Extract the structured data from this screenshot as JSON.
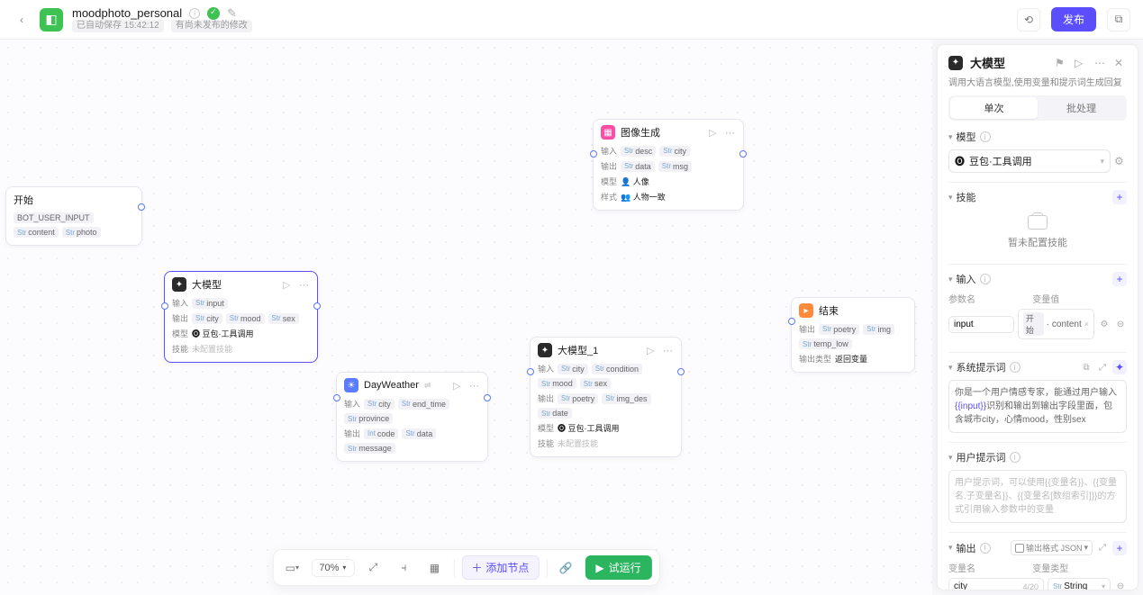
{
  "header": {
    "title": "moodphoto_personal",
    "saved": "已自动保存 15:42:12",
    "unpub": "有尚未发布的修改",
    "publish": "发布"
  },
  "nodes": {
    "start": {
      "title": "开始",
      "labels": [
        "BOT_USER_INPUT",
        "content",
        "photo"
      ]
    },
    "llm": {
      "title": "大模型",
      "in_lbl": "输入",
      "in": [
        "input"
      ],
      "out_lbl": "输出",
      "out": [
        "city",
        "mood",
        "sex"
      ],
      "model_lbl": "模型",
      "model": "豆包·工具调用",
      "skill_lbl": "技能",
      "skill": "未配置技能"
    },
    "weather": {
      "title": "DayWeather",
      "in_lbl": "输入",
      "in": [
        "city",
        "end_time",
        "province"
      ],
      "out_lbl": "输出",
      "out": [
        "code",
        "data",
        "message"
      ]
    },
    "llm1": {
      "title": "大模型_1",
      "in_lbl": "输入",
      "in": [
        "city",
        "condition",
        "mood",
        "sex"
      ],
      "out_lbl": "输出",
      "out": [
        "poetry",
        "img_des",
        "date"
      ],
      "model_lbl": "模型",
      "model": "豆包·工具调用",
      "skill_lbl": "技能",
      "skill": "未配置技能"
    },
    "img": {
      "title": "图像生成",
      "in_lbl": "输入",
      "in": [
        "desc",
        "city"
      ],
      "out_lbl": "输出",
      "out": [
        "data",
        "msg"
      ],
      "model_lbl": "模型",
      "model": "人像",
      "style_lbl": "样式",
      "style": "人物一致"
    },
    "end": {
      "title": "结束",
      "out_lbl": "输出",
      "out": [
        "poetry",
        "img",
        "temp_low"
      ],
      "mode_lbl": "输出类型",
      "mode": "返回变量"
    }
  },
  "bottom": {
    "zoom": "70%",
    "add": "添加节点",
    "run": "试运行"
  },
  "panel": {
    "title": "大模型",
    "desc": "调用大语言模型,使用变量和提示词生成回复",
    "tab_single": "单次",
    "tab_batch": "批处理",
    "sec_model": "模型",
    "model_val": "豆包·工具调用",
    "sec_skill": "技能",
    "skill_empty": "暂未配置技能",
    "sec_input": "输入",
    "col_name": "参数名",
    "col_val": "变量值",
    "in_name": "input",
    "in_src": "开始",
    "in_field": "content",
    "sec_sys": "系统提示词",
    "sys_text_a": "你是一个用户情感专家，能通过用户输入",
    "sys_text_var": "{{input}}",
    "sys_text_b": "识别和输出到输出字段里面，包含城市city，心情mood，性别sex",
    "sec_user": "用户提示词",
    "user_ph": "用户提示词，可以使用{{变量名}}、{{变量名.子变量名}}、{{变量名[数组索引]}}的方式引用输入参数中的变量",
    "sec_output": "输出",
    "fmt": "输出格式 JSON",
    "out_col_name": "变量名",
    "out_col_type": "变量类型",
    "out_name": "city",
    "out_cnt": "4/20",
    "out_type": "String"
  }
}
